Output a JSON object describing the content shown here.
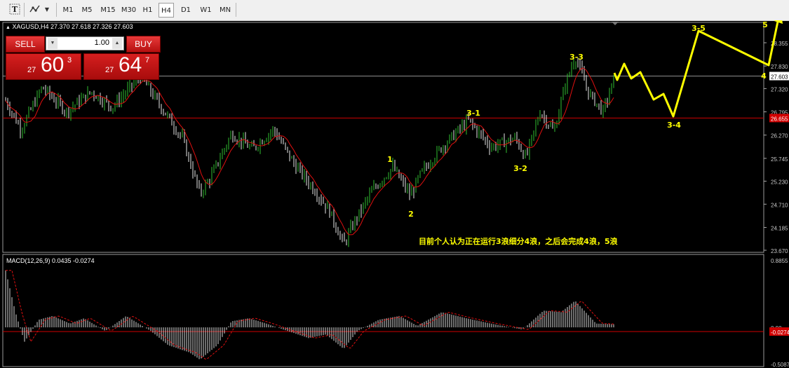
{
  "toolbar": {
    "tools": [
      "text-tool-icon",
      "objects-tool-icon",
      "dropdown-arrow-icon"
    ],
    "timeframes": [
      "M1",
      "M5",
      "M15",
      "M30",
      "H1",
      "H4",
      "D1",
      "W1",
      "MN"
    ],
    "active_timeframe": "H4"
  },
  "header": {
    "symbol": "XAGUSD,H4",
    "ohlc": "27.370 27.618 27.326 27.603"
  },
  "trade_panel": {
    "sell_label": "SELL",
    "buy_label": "BUY",
    "lot_value": "1.00",
    "sell_prefix": "27",
    "sell_big": "60",
    "sell_sup": "3",
    "buy_prefix": "27",
    "buy_big": "64",
    "buy_sup": "7"
  },
  "price_axis": {
    "labels": [
      "28.355",
      "27.830",
      "27.320",
      "26.795",
      "26.270",
      "25.745",
      "25.230",
      "24.710",
      "24.185",
      "23.670"
    ],
    "current_price": "27.603",
    "red_line_price": "26.655"
  },
  "macd": {
    "title": "MACD(12,26,9) 0.0435 -0.0274",
    "axis_labels": [
      "0.8855",
      "0.00",
      "-0.5087"
    ],
    "signal_tag": "-0.0274"
  },
  "wave_labels": [
    "1",
    "2",
    "3-1",
    "3-2",
    "3-3",
    "3-4",
    "3-5",
    "4",
    "5"
  ],
  "annotation": "目前个人认为正在运行3浪细分4浪，之后会完成4浪，5浪",
  "colors": {
    "background": "#000000",
    "bull_candle": "#2fbe2f",
    "bear_candle": "#e8e8e8",
    "moving_average": "#e01010",
    "horizontal_line": "#d00000",
    "wave_annotation": "#ffff00",
    "trade_button": "#cc1414",
    "macd_histogram": "#d8d8d8"
  }
}
